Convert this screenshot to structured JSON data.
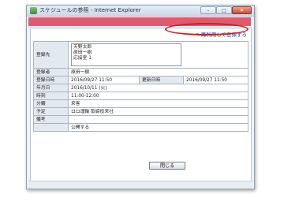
{
  "window": {
    "title": "スケジュールの参照 - Internet Explorer",
    "buttons": {
      "minimize": "–",
      "maximize": "□",
      "close": "✕"
    }
  },
  "reuse_link": {
    "label": "再利用して登録する",
    "icon": "pencil-icon"
  },
  "form": {
    "rows": [
      {
        "label": "登録先",
        "lines": [
          "天野太郎",
          "原田一樹",
          "応接室 1"
        ]
      },
      {
        "label": "登録者",
        "value": "原田一樹"
      },
      {
        "label": "登録日時",
        "value": "2016/09/27 11:50",
        "label2": "更新日時",
        "value2": "2016/09/27 11:50"
      },
      {
        "label": "年月日",
        "value": "2016/10/11 (火)"
      },
      {
        "label": "時刻",
        "value": "11:00-12:00"
      },
      {
        "label": "分類",
        "value": "来客"
      },
      {
        "label": "予定",
        "value": "ロロ運輸 取締役来社"
      },
      {
        "label": "備考",
        "value": ""
      },
      {
        "label": "",
        "value": "公開する"
      }
    ]
  },
  "close_button": {
    "label": "閉じる"
  },
  "colors": {
    "accent_bar": "#e05a6e",
    "highlight_ring": "#d21c1c",
    "link": "#1a3fae"
  }
}
